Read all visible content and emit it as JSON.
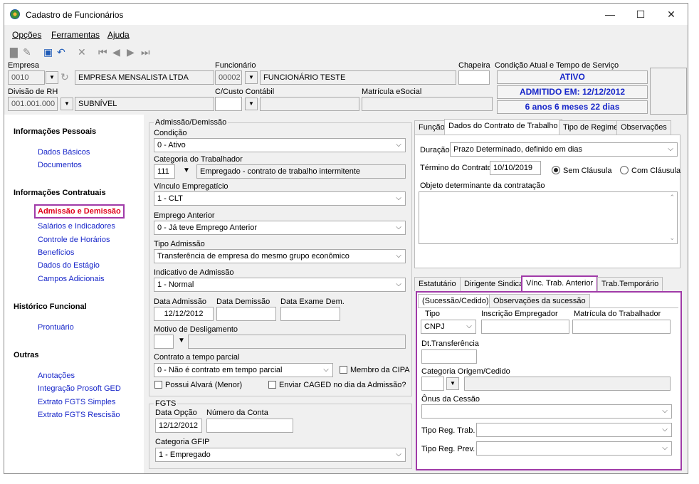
{
  "window": {
    "title": "Cadastro de Funcionários",
    "minimize": "—",
    "maximize": "☐",
    "close": "✕"
  },
  "menu": [
    "Opções",
    "Ferramentas",
    "Ajuda"
  ],
  "header": {
    "empresa_label": "Empresa",
    "empresa_code": "0010",
    "empresa_name": "EMPRESA MENSALISTA LTDA",
    "funcionario_label": "Funcionário",
    "funcionario_code": "00002",
    "funcionario_name": "FUNCIONÁRIO TESTE",
    "chapeira_label": "Chapeira",
    "chapeira_value": "",
    "condicao_label": "Condição Atual e Tempo de Serviço",
    "status_ativo": "ATIVO",
    "status_admitido": "ADMITIDO EM: 12/12/2012",
    "status_tempo": "6 anos 6 meses 22 dias",
    "divisao_label": "Divisão de RH",
    "divisao_code": "001.001.000",
    "divisao_name": "SUBNÍVEL",
    "custo_label": "C/Custo Contábil",
    "esocial_label": "Matrícula eSocial"
  },
  "sidebar": {
    "sections": [
      {
        "title": "Informações Pessoais",
        "items": [
          "Dados Básicos",
          "Documentos"
        ]
      },
      {
        "title": "Informações Contratuais",
        "items": [
          "Admissão e Demissão",
          "Salários e Indicadores",
          "Controle de Horários",
          "Benefícios",
          "Dados do Estágio",
          "Campos Adicionais"
        ]
      },
      {
        "title": "Histórico Funcional",
        "items": [
          "Prontuário"
        ]
      },
      {
        "title": "Outras",
        "items": [
          "Anotações",
          "Integração Prosoft GED",
          "Extrato FGTS Simples",
          "Extrato FGTS Rescisão"
        ]
      }
    ]
  },
  "admissao": {
    "group_title": "Admissão/Demissão",
    "condicao_label": "Condição",
    "condicao_value": "0 - Ativo",
    "categoria_label": "Categoria do Trabalhador",
    "categoria_code": "111",
    "categoria_desc": "Empregado - contrato de trabalho intermitente",
    "vinculo_label": "Vínculo Empregatício",
    "vinculo_value": "1 - CLT",
    "emprego_label": "Emprego Anterior",
    "emprego_value": "0 - Já teve Emprego Anterior",
    "tipo_label": "Tipo Admissão",
    "tipo_value": "Transferência de empresa do mesmo grupo econômico",
    "indicativo_label": "Indicativo de Admissão",
    "indicativo_value": "1 - Normal",
    "data_admissao_label": "Data Admissão",
    "data_admissao_value": "12/12/2012",
    "data_demissao_label": "Data Demissão",
    "data_exame_label": "Data Exame Dem.",
    "motivo_label": "Motivo de Desligamento",
    "parcial_label": "Contrato a tempo parcial",
    "parcial_value": "0 - Não é contrato em tempo parcial",
    "cipa_label": "Membro da CIPA",
    "alvara_label": "Possui Alvará (Menor)",
    "caged_label": "Enviar CAGED no dia da Admissão?"
  },
  "fgts": {
    "group_title": "FGTS",
    "data_opcao_label": "Data Opção",
    "data_opcao_value": "12/12/2012",
    "conta_label": "Número da Conta",
    "gfip_label": "Categoria GFIP",
    "gfip_value": "1 - Empregado"
  },
  "contract_tabs": [
    "Função",
    "Dados do Contrato de Trabalho",
    "Tipo de Regime",
    "Observações"
  ],
  "contrato": {
    "duracao_label": "Duração",
    "duracao_value": "Prazo Determinado, definido em dias",
    "termino_label": "Término do Contrato",
    "termino_value": "10/10/2019",
    "sem_clausula": "Sem Cláusula",
    "com_clausula": "Com Cláusula",
    "objeto_label": "Objeto determinante da contratação"
  },
  "lower_tabs": [
    "Estatutário",
    "Dirigente Sindical",
    "Vínc. Trab. Anterior",
    "Trab.Temporário"
  ],
  "sub_tabs": [
    "(Sucessão/Cedido)",
    "Observações da sucessão"
  ],
  "vinculo_anterior": {
    "tipo_label": "Tipo",
    "tipo_value": "CNPJ",
    "inscricao_label": "Inscrição Empregador",
    "matricula_label": "Matrícula do Trabalhador",
    "dt_transf_label": "Dt.Transferência",
    "categoria_label": "Categoria Origem/Cedido",
    "onus_label": "Ônus da Cessão",
    "tipo_reg_trab_label": "Tipo Reg. Trab.",
    "tipo_reg_prev_label": "Tipo Reg. Prev."
  }
}
